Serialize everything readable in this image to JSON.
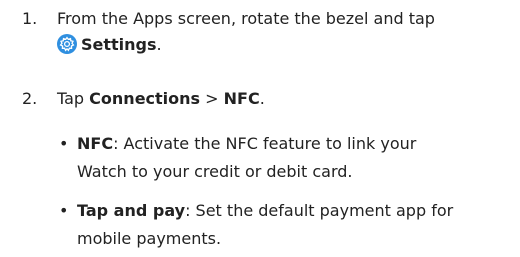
{
  "steps": [
    {
      "number": "1.",
      "line1": "From the Apps screen, rotate the bezel and tap",
      "settings_label": "Settings",
      "trailing": "."
    },
    {
      "number": "2.",
      "lead": "Tap ",
      "connections": "Connections",
      "separator": " > ",
      "nfc": "NFC",
      "trailing": "."
    }
  ],
  "bullets": [
    {
      "marker": "•",
      "term": "NFC",
      "line1_rest": ": Activate the NFC feature to link your",
      "line2": "Watch to your credit or debit card."
    },
    {
      "marker": "•",
      "term": "Tap and pay",
      "line1_rest": ": Set the default payment app for",
      "line2": "mobile payments."
    }
  ],
  "icons": {
    "settings": "gear-icon",
    "settings_color": "#2f8fe0"
  }
}
